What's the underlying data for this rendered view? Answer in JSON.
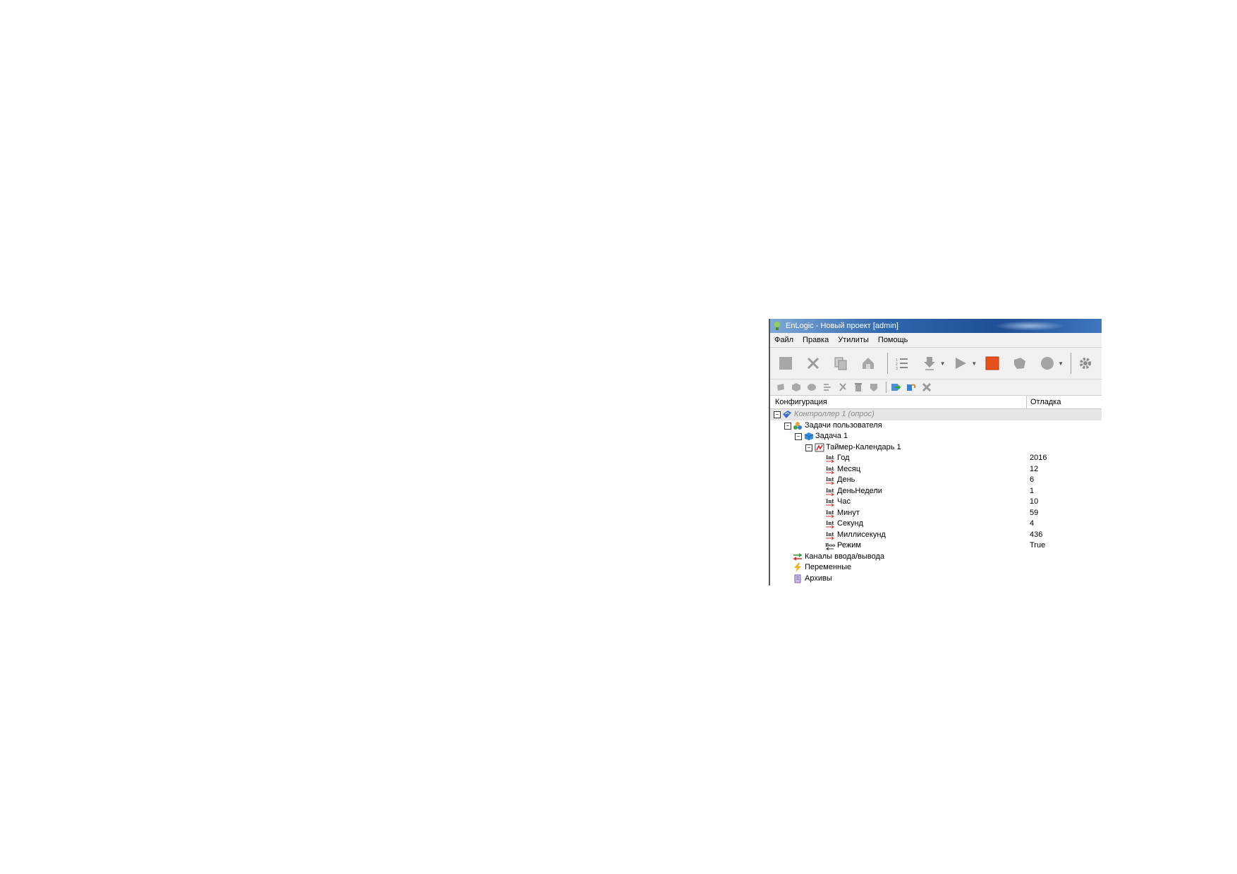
{
  "window": {
    "title": "EnLogic - Новый проект [admin]"
  },
  "menu": {
    "items": [
      "Файл",
      "Правка",
      "Утилиты",
      "Помощь"
    ]
  },
  "toolbar": {
    "buttons": [
      "stop-icon",
      "cut-icon",
      "copy-icon",
      "paste-icon",
      "list-icon",
      "download-icon",
      "run-icon",
      "stop-red-icon",
      "shapes-icon",
      "circle-icon",
      "gear-icon"
    ]
  },
  "columns": {
    "config": "Конфигурация",
    "debug": "Отладка"
  },
  "tree": {
    "controller": "Контроллер 1 (опрос)",
    "user_tasks": "Задачи пользователя",
    "task": "Задача 1",
    "timer": "Таймер-Календарь 1",
    "params": [
      {
        "name": "Год",
        "type": "Int",
        "value": "2016"
      },
      {
        "name": "Месяц",
        "type": "Int",
        "value": "12"
      },
      {
        "name": "День",
        "type": "Int",
        "value": "6"
      },
      {
        "name": "ДеньНедели",
        "type": "Int",
        "value": "1"
      },
      {
        "name": "Час",
        "type": "Int",
        "value": "10"
      },
      {
        "name": "Минут",
        "type": "Int",
        "value": "59"
      },
      {
        "name": "Секунд",
        "type": "Int",
        "value": "4"
      },
      {
        "name": "Миллисекунд",
        "type": "Int",
        "value": "436"
      },
      {
        "name": "Режим",
        "type": "Bool",
        "value": "True"
      }
    ],
    "io_channels": "Каналы ввода/вывода",
    "variables": "Переменные",
    "archives": "Архивы"
  },
  "colors": {
    "title_bar": "#1f4f95",
    "accent_stop": "#e8501c",
    "selected_row": "#e6e6e6"
  }
}
